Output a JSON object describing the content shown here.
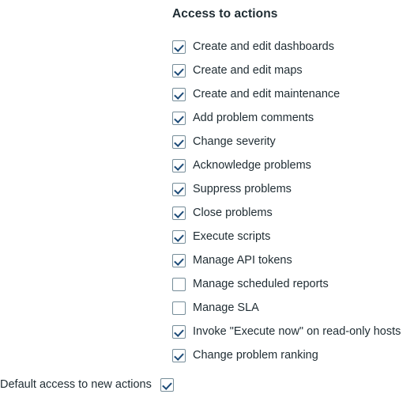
{
  "panel": {
    "title": "Access to actions",
    "items": [
      {
        "label": "Create and edit dashboards",
        "checked": true
      },
      {
        "label": "Create and edit maps",
        "checked": true
      },
      {
        "label": "Create and edit maintenance",
        "checked": true
      },
      {
        "label": "Add problem comments",
        "checked": true
      },
      {
        "label": "Change severity",
        "checked": true
      },
      {
        "label": "Acknowledge problems",
        "checked": true
      },
      {
        "label": "Suppress problems",
        "checked": true
      },
      {
        "label": "Close problems",
        "checked": true
      },
      {
        "label": "Execute scripts",
        "checked": true
      },
      {
        "label": "Manage API tokens",
        "checked": true
      },
      {
        "label": "Manage scheduled reports",
        "checked": false
      },
      {
        "label": "Manage SLA",
        "checked": false
      },
      {
        "label": "Invoke \"Execute now\" on read-only hosts",
        "checked": true
      },
      {
        "label": "Change problem ranking",
        "checked": true
      }
    ]
  },
  "default_access": {
    "label": "Default access to new actions",
    "checked": true
  },
  "colors": {
    "text": "#1f2c33",
    "checkbox_border": "#768d99",
    "checkmark": "#1d4b78",
    "background": "#ffffff"
  }
}
